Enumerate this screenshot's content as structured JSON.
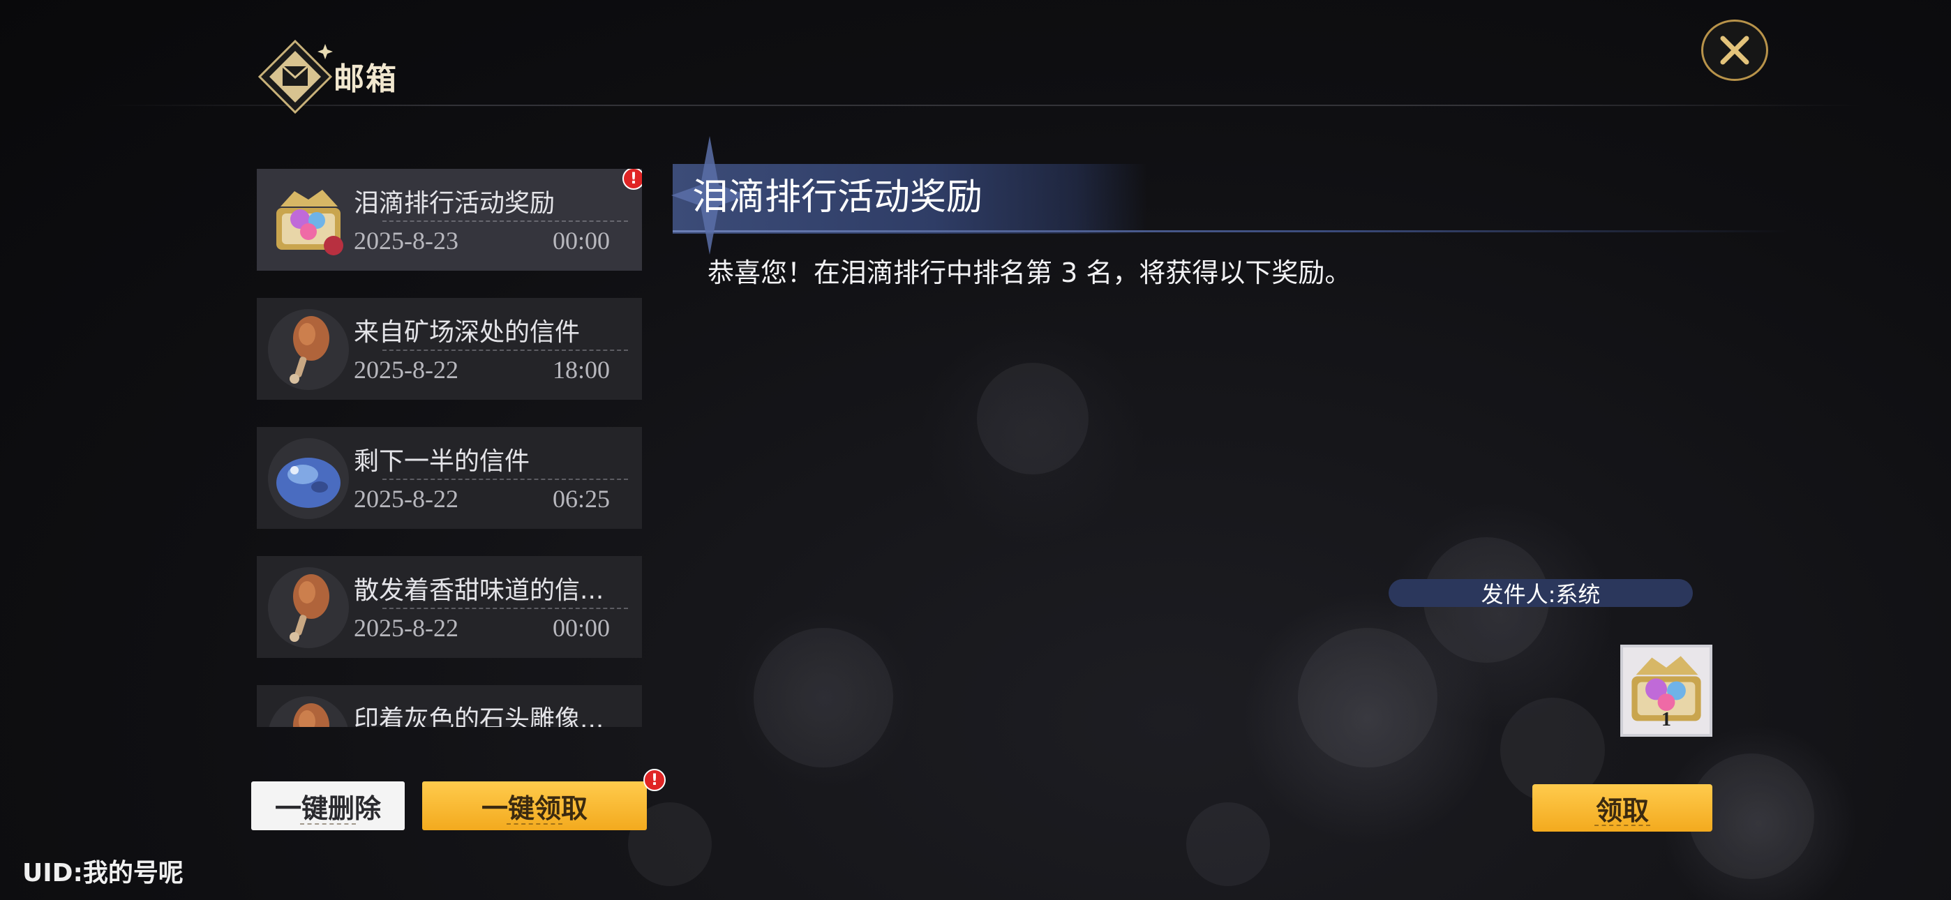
{
  "header": {
    "title": "邮箱"
  },
  "mails": [
    {
      "subject": "泪滴排行活动奖励",
      "date": "2025-8-23",
      "time": "00:00",
      "icon": "treasure-chest-icon",
      "unread": true,
      "selected": true
    },
    {
      "subject": "来自矿场深处的信件",
      "date": "2025-8-22",
      "time": "18:00",
      "icon": "drumstick-icon",
      "unread": false,
      "selected": false
    },
    {
      "subject": "剩下一半的信件",
      "date": "2025-8-22",
      "time": "06:25",
      "icon": "blue-slime-icon",
      "unread": false,
      "selected": false
    },
    {
      "subject": "散发着香甜味道的信...",
      "date": "2025-8-22",
      "time": "00:00",
      "icon": "drumstick-icon",
      "unread": false,
      "selected": false
    },
    {
      "subject": "印着灰色的石头雕像...",
      "date": "",
      "time": "",
      "icon": "drumstick-icon",
      "unread": false,
      "selected": false
    }
  ],
  "detail": {
    "title": "泪滴排行活动奖励",
    "body": "恭喜您！在泪滴排行中排名第 3 名，将获得以下奖励。",
    "sender": "发件人:系统",
    "rewards": [
      {
        "icon": "treasure-chest-icon",
        "count": "1"
      }
    ]
  },
  "buttons": {
    "delete_all": "一键删除",
    "claim_all": "一键领取",
    "claim": "领取"
  },
  "footer": {
    "uid": "UID:我的号呢"
  },
  "colors": {
    "accent_gold": "#f3aa1e",
    "banner_blue": "#3c4c78",
    "badge_red": "#e02525"
  }
}
